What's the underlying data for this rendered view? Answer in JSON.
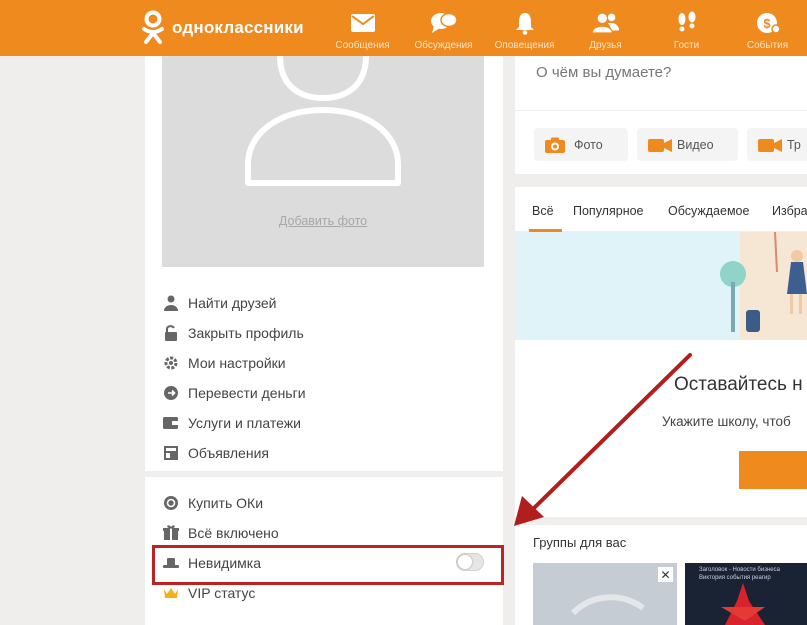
{
  "app": {
    "logo_text": "одноклассники"
  },
  "nav": {
    "items": [
      {
        "label": "Сообщения",
        "icon": "envelope-icon"
      },
      {
        "label": "Обсуждения",
        "icon": "speech-bubbles-icon"
      },
      {
        "label": "Оповещения",
        "icon": "bell-icon"
      },
      {
        "label": "Друзья",
        "icon": "friends-icon"
      },
      {
        "label": "Гости",
        "icon": "footprints-icon"
      },
      {
        "label": "События",
        "icon": "events-icon"
      }
    ]
  },
  "profile": {
    "add_photo": "Добавить фото"
  },
  "menu": {
    "items": [
      {
        "label": "Найти друзей",
        "icon": "person-icon"
      },
      {
        "label": "Закрыть профиль",
        "icon": "lock-icon"
      },
      {
        "label": "Мои настройки",
        "icon": "gear-icon"
      },
      {
        "label": "Перевести деньги",
        "icon": "money-transfer-icon"
      },
      {
        "label": "Услуги и платежи",
        "icon": "wallet-icon"
      },
      {
        "label": "Объявления",
        "icon": "ads-icon"
      }
    ],
    "extra": [
      {
        "label": "Купить ОКи",
        "icon": "ok-coin-icon"
      },
      {
        "label": "Всё включено",
        "icon": "all-inclusive-icon"
      },
      {
        "label": "Невидимка",
        "icon": "invisible-hat-icon",
        "enabled": false
      },
      {
        "label": "VIP статус",
        "icon": "crown-icon"
      }
    ]
  },
  "post": {
    "placeholder": "О чём вы думаете?",
    "buttons": [
      {
        "label": "Фото",
        "icon": "camera-icon"
      },
      {
        "label": "Видео",
        "icon": "video-icon"
      },
      {
        "label": "Тр",
        "icon": "video-icon"
      }
    ]
  },
  "feed": {
    "tabs": [
      "Всё",
      "Популярное",
      "Обсуждаемое",
      "Избра"
    ],
    "active_tab": "Всё",
    "promo_title": "Оставайтесь н",
    "promo_subtitle": "Укажите школу, чтоб"
  },
  "groups": {
    "title": "Группы для вас",
    "card2_lines": [
      "Заголовок - Новости бизнеса",
      "Виктория события реагир"
    ]
  },
  "colors": {
    "brand": "#ef8a1e",
    "highlight_box": "#bd2323",
    "arrow": "#b01e1e"
  }
}
